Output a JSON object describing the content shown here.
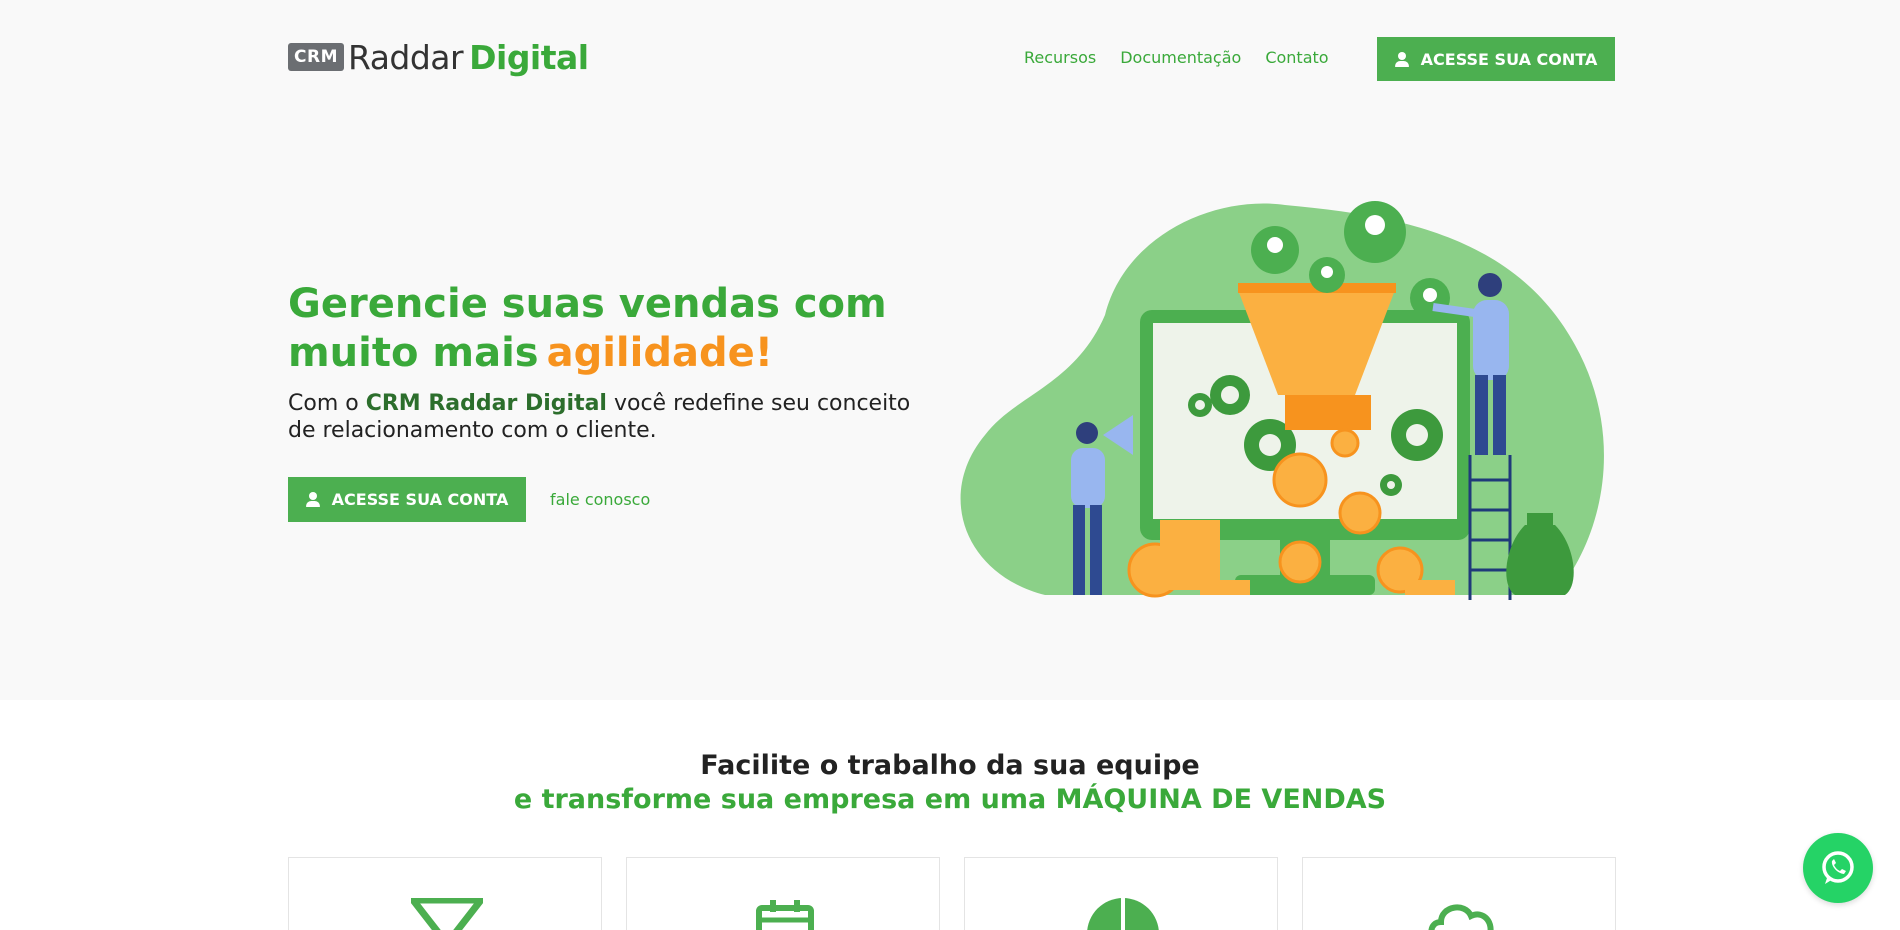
{
  "header": {
    "logo_badge": "CRM",
    "logo_name": "Raddar",
    "logo_digital": "Digital",
    "nav": [
      "Recursos",
      "Documentação",
      "Contato"
    ],
    "cta_label": "ACESSE SUA CONTA"
  },
  "hero": {
    "headline_main": "Gerencie suas vendas com muito mais",
    "headline_accent": "agilidade!",
    "sub_prefix": "Com o ",
    "sub_brand": "CRM Raddar Digital",
    "sub_suffix": " você redefine seu conceito de relacionamento com o cliente.",
    "cta_label": "ACESSE SUA CONTA",
    "secondary_link": "fale conosco"
  },
  "features": {
    "title_line1": "Facilite o trabalho da sua equipe",
    "title_line2": "e transforme sua empresa em uma MÁQUINA DE VENDAS",
    "card_icons": [
      "funnel-icon",
      "calendar-icon",
      "pie-chart-icon",
      "cloud-icon"
    ]
  },
  "colors": {
    "brand_green": "#4caf50",
    "accent_orange": "#f7931e",
    "whatsapp_green": "#25d366"
  }
}
